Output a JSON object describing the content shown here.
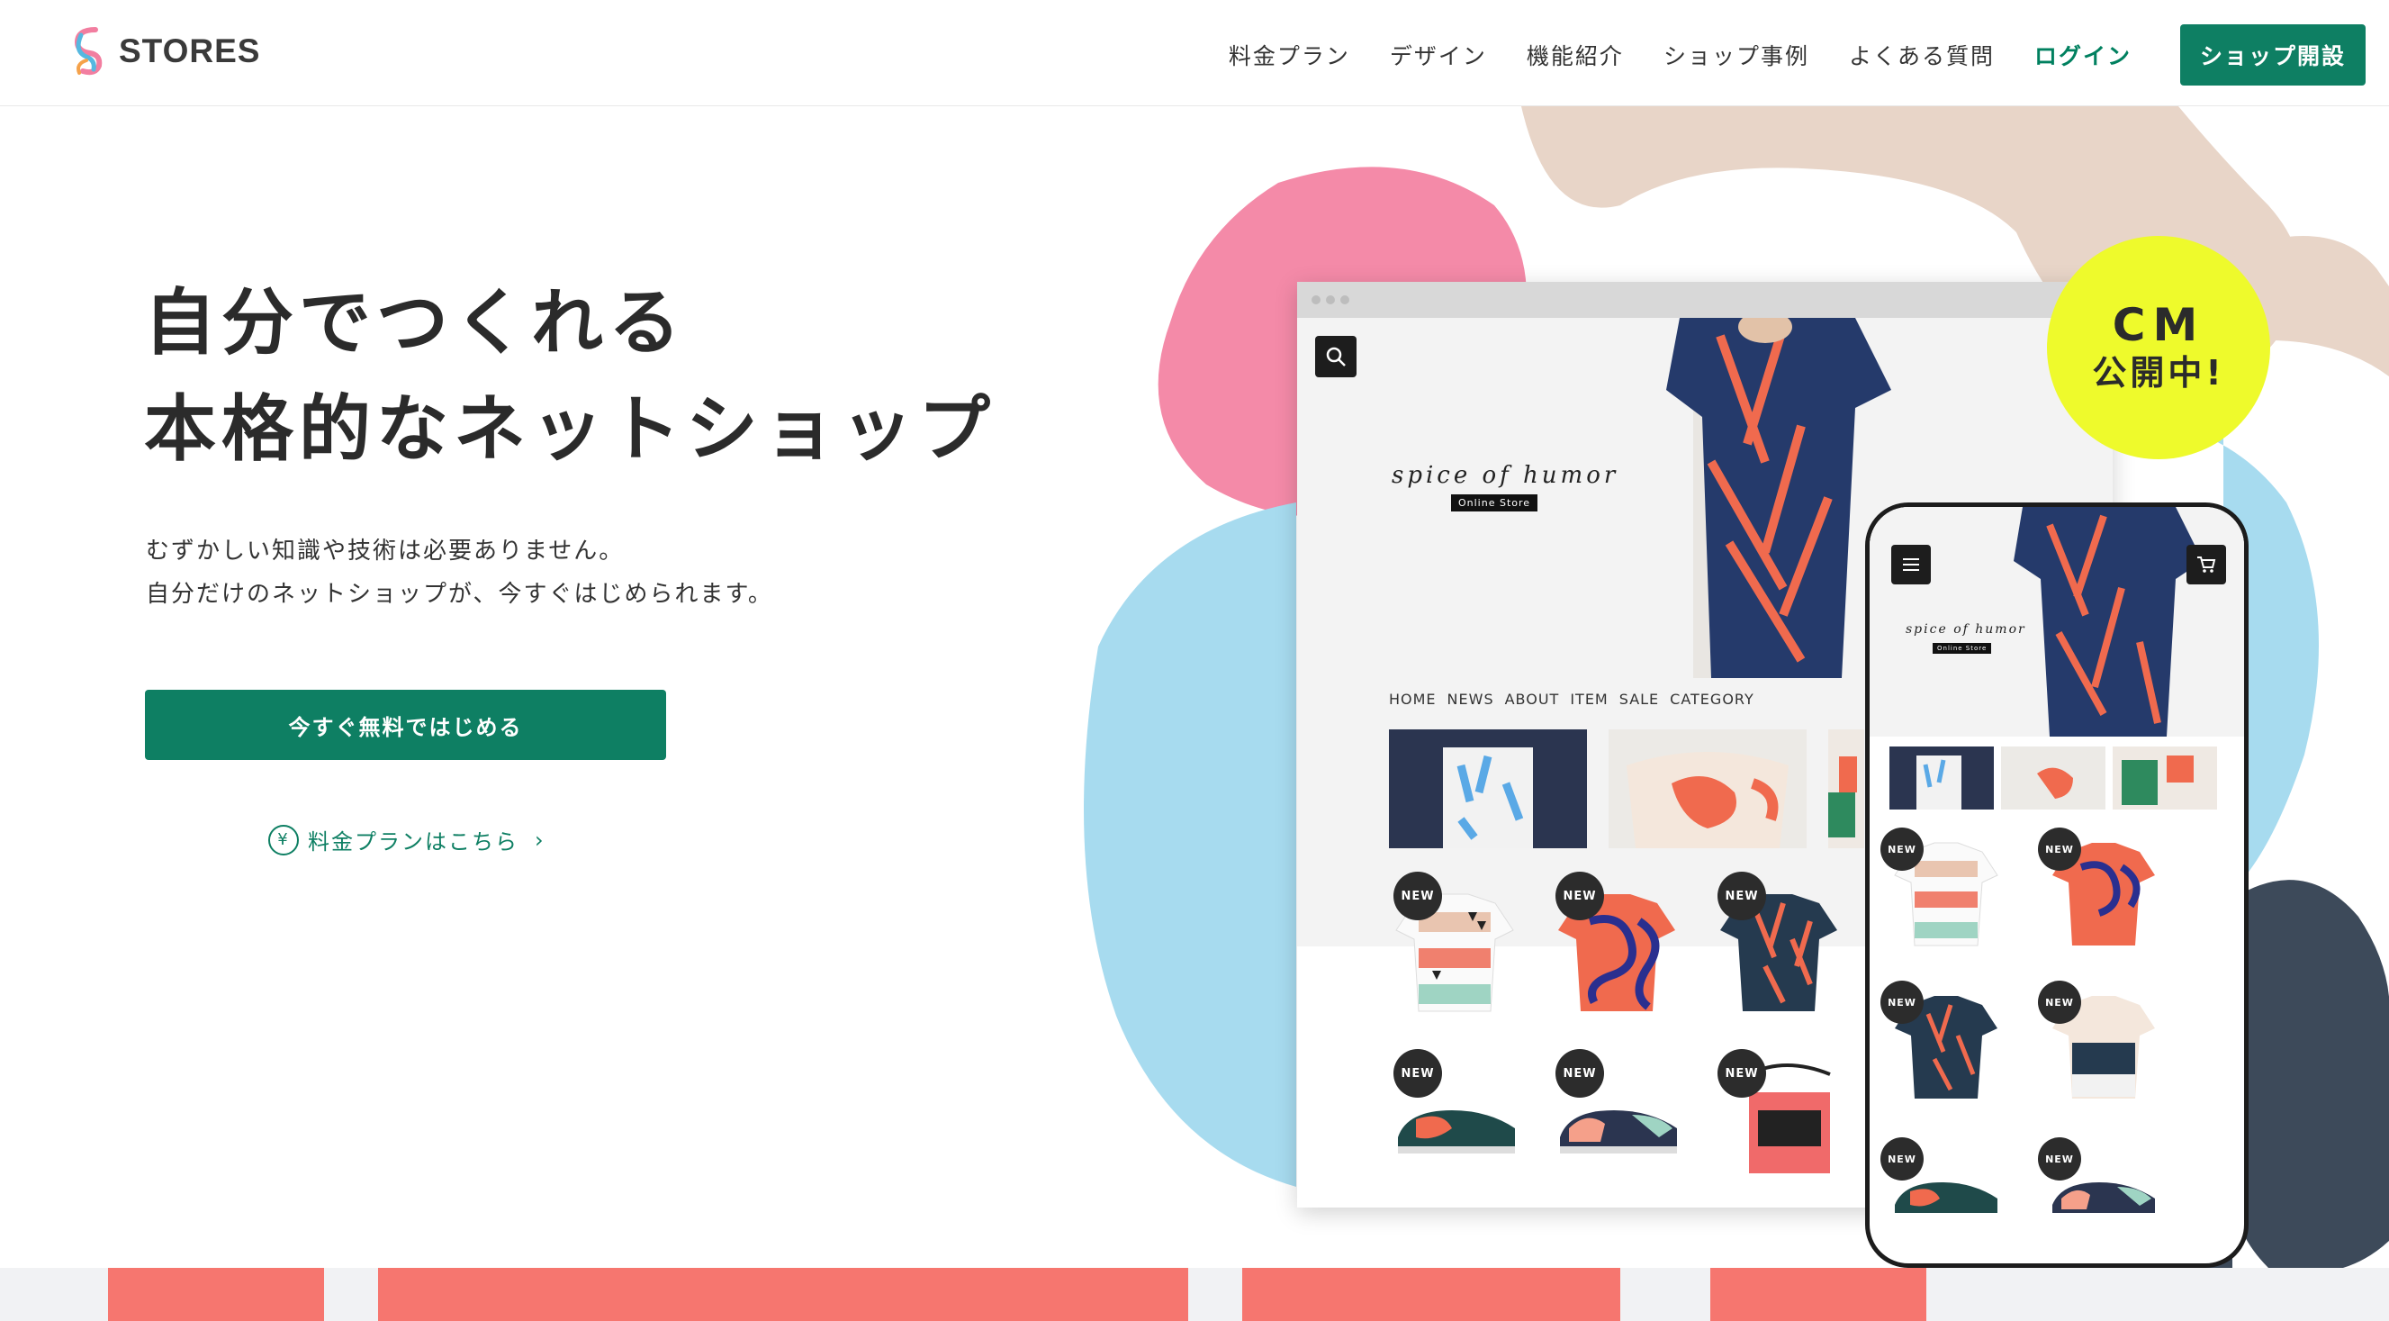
{
  "header": {
    "logo_text": "STORES",
    "nav": [
      "料金プラン",
      "デザイン",
      "機能紹介",
      "ショップ事例",
      "よくある質問"
    ],
    "login_label": "ログイン",
    "open_shop_label": "ショップ開設"
  },
  "hero": {
    "title_line1": "自分でつくれる",
    "title_line2": "本格的なネットショップ",
    "subtitle_line1": "むずかしい知識や技術は必要ありません。",
    "subtitle_line2": "自分だけのネットショップが、今すぐはじめられます。",
    "cta_label": "今すぐ無料ではじめる",
    "pricing_link_label": "料金プランはこちら",
    "yen_symbol": "¥"
  },
  "badge": {
    "line1": "CM",
    "line2": "公開中!"
  },
  "mockup": {
    "brand_name": "spice of humor",
    "brand_tag": "Online Store",
    "shop_nav": [
      "HOME",
      "NEWS",
      "ABOUT",
      "ITEM",
      "SALE",
      "CATEGORY"
    ],
    "new_label": "NEW"
  },
  "colors": {
    "brand_green": "#0e7f63",
    "pink": "#f48aa8",
    "light_blue": "#a7dbef",
    "beige": "#e8d5c8",
    "navy": "#3d4a5a",
    "badge_yellow": "#eefa2c"
  }
}
